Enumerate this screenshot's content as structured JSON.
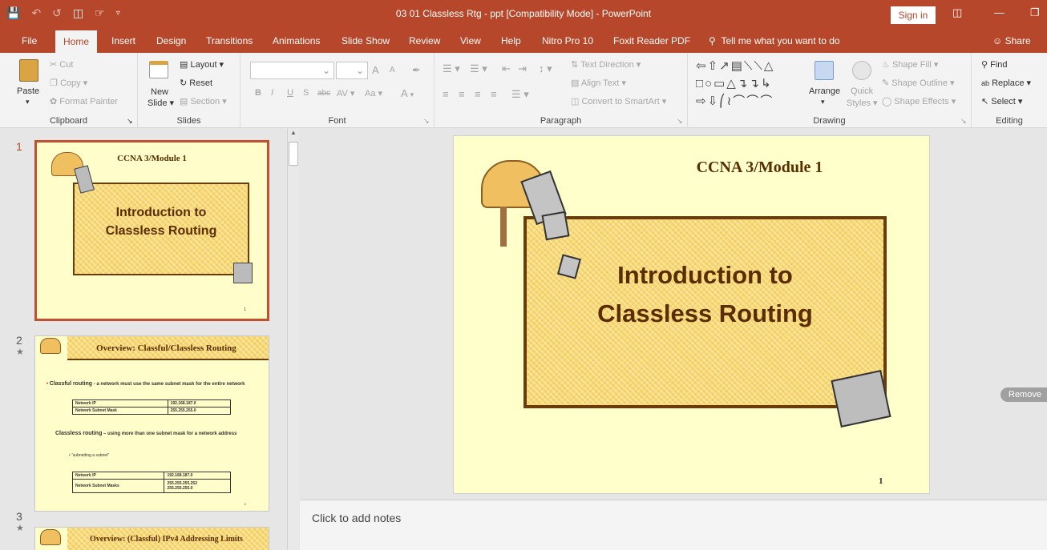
{
  "window": {
    "title": "03 01 Classless Rtg - ppt [Compatibility Mode]  -  PowerPoint",
    "sign_in": "Sign in"
  },
  "tabs": [
    "File",
    "Home",
    "Insert",
    "Design",
    "Transitions",
    "Animations",
    "Slide Show",
    "Review",
    "View",
    "Help",
    "Nitro Pro 10",
    "Foxit Reader PDF"
  ],
  "tell_me": "Tell me what you want to do",
  "share": "Share",
  "ribbon": {
    "clipboard": {
      "label": "Clipboard",
      "paste": "Paste",
      "cut": "Cut",
      "copy": "Copy",
      "format_painter": "Format Painter"
    },
    "slides": {
      "label": "Slides",
      "new_slide": "New",
      "new_slide2": "Slide",
      "layout": "Layout",
      "reset": "Reset",
      "section": "Section"
    },
    "font": {
      "label": "Font",
      "size_up": "A",
      "size_down": "A",
      "bold": "B",
      "italic": "I",
      "underline": "U",
      "shadow": "S",
      "strike": "abc",
      "spacing": "AV",
      "case": "Aa",
      "color": "A"
    },
    "paragraph": {
      "label": "Paragraph",
      "text_direction": "Text Direction",
      "align_text": "Align Text",
      "smartart": "Convert to SmartArt"
    },
    "drawing": {
      "label": "Drawing",
      "arrange": "Arrange",
      "quick_styles": "Quick",
      "quick_styles2": "Styles",
      "shape_fill": "Shape Fill",
      "shape_outline": "Shape Outline",
      "shape_effects": "Shape Effects"
    },
    "editing": {
      "label": "Editing",
      "find": "Find",
      "replace": "Replace",
      "select": "Select"
    }
  },
  "thumbnails": [
    {
      "number": "1",
      "header": "CCNA 3/Module 1",
      "title_line1": "Introduction to",
      "title_line2": "Classless Routing",
      "page": "1"
    },
    {
      "number": "2",
      "star": "★",
      "header": "Overview:   Classful/Classless Routing",
      "bullet1_bold": "Classful routing",
      "bullet1_rest": " - a network must use the same subnet mask for the entire network",
      "table1": [
        [
          "Network IP",
          "192.168.187.0"
        ],
        [
          "Network Subnet Mask",
          "255.255.255.0"
        ]
      ],
      "bullet2_bold": "Classless routing",
      "bullet2_rest": " – using more than one subnet mask for a network address",
      "sub": "“subnetting a subnet”",
      "table2": [
        [
          "Network IP",
          "192.168.187.0"
        ],
        [
          "Network Subnet Masks",
          "255.255.255.252\n255.255.255.0"
        ]
      ],
      "page": "2"
    },
    {
      "number": "3",
      "star": "★",
      "header": "Overview:  (Classful) IPv4 Addressing Limits"
    }
  ],
  "slide": {
    "header": "CCNA 3/Module 1",
    "title_line1": "Introduction to",
    "title_line2": "Classless Routing",
    "page": "1"
  },
  "notes_placeholder": "Click to add notes",
  "remove_badge": "Remove",
  "colors": {
    "accent": "#b7472a",
    "slide_bg": "#ffffcc",
    "title_text": "#5a2d00"
  }
}
